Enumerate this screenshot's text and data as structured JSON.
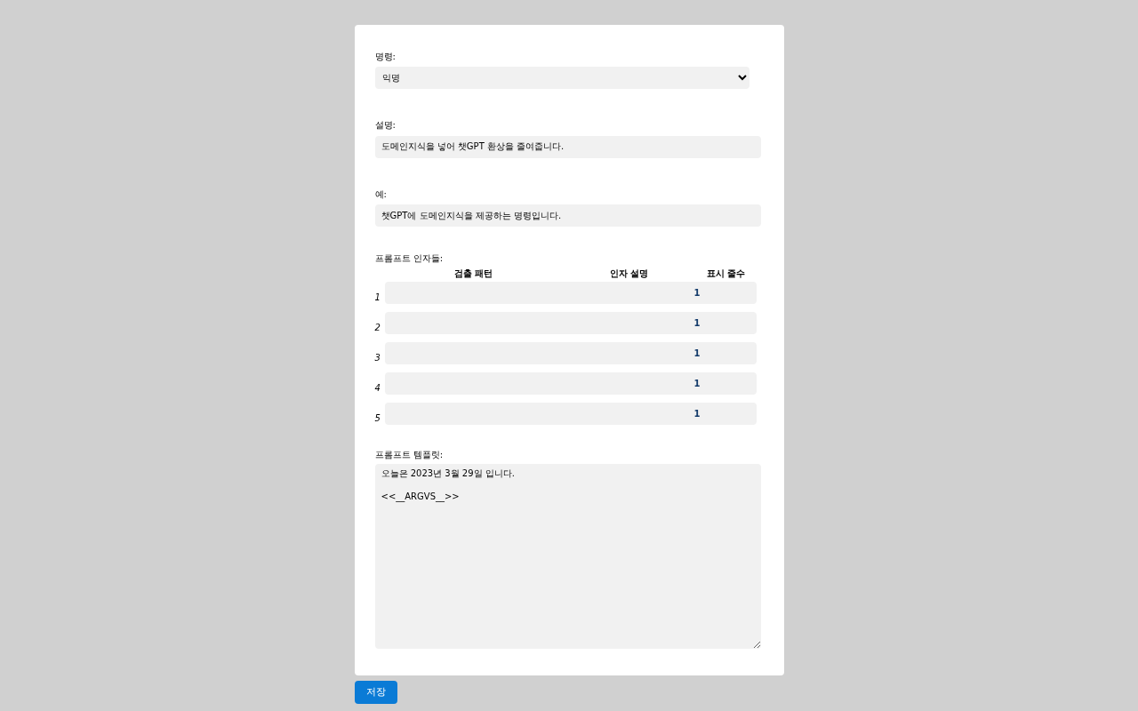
{
  "command": {
    "label": "명령:",
    "value": "익명"
  },
  "description": {
    "label": "설명:",
    "value": "도메인지식을 넣어 챗GPT 환상을 줄여줍니다."
  },
  "example": {
    "label": "예:",
    "value": "챗GPT에 도메인지식을 제공하는 명령입니다."
  },
  "arguments": {
    "label": "프롬프트 인자들:",
    "columns": [
      "검출 패턴",
      "인자 설명",
      "표시 줄수"
    ],
    "rows": [
      {
        "number": "1",
        "lines": "1"
      },
      {
        "number": "2",
        "lines": "1"
      },
      {
        "number": "3",
        "lines": "1"
      },
      {
        "number": "4",
        "lines": "1"
      },
      {
        "number": "5",
        "lines": "1"
      }
    ]
  },
  "template": {
    "label": "프롬프트 템플릿:",
    "value": "오늘은 2023년 3월 29일 입니다.\n\n<<__ARGVS__>>"
  },
  "save_button": "저장"
}
